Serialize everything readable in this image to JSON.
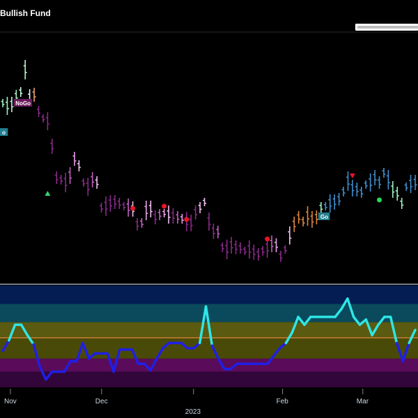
{
  "title": "Bullish Fund",
  "chart_data": {
    "type": "ohlc",
    "price_bars": [
      {
        "v": 148,
        "c": "#9ff0c0"
      },
      {
        "v": 152,
        "c": "#9ff0c0"
      },
      {
        "v": 150,
        "c": "#b8f5d0"
      },
      {
        "v": 138,
        "c": "#9ff0c0"
      },
      {
        "v": 132,
        "c": "#c8f7dc"
      },
      {
        "v": 100,
        "c": "#b8f5d0"
      },
      {
        "v": 140,
        "c": "#e8eefc"
      },
      {
        "v": 136,
        "c": "#f0a070"
      },
      {
        "v": 160,
        "c": "#8a2a8a"
      },
      {
        "v": 170,
        "c": "#8a2a8a"
      },
      {
        "v": 174,
        "c": "#8a2a8a"
      },
      {
        "v": 210,
        "c": "#8a2a8a"
      },
      {
        "v": 255,
        "c": "#8a2a8a"
      },
      {
        "v": 258,
        "c": "#8a2a8a"
      },
      {
        "v": 262,
        "c": "#8a2a8a"
      },
      {
        "v": 252,
        "c": "#c060c0"
      },
      {
        "v": 228,
        "c": "#e8a0e8"
      },
      {
        "v": 238,
        "c": "#f0c0f0"
      },
      {
        "v": 262,
        "c": "#8a2a8a"
      },
      {
        "v": 268,
        "c": "#8a2a8a"
      },
      {
        "v": 258,
        "c": "#c060c0"
      },
      {
        "v": 262,
        "c": "#f0c0f0"
      },
      {
        "v": 298,
        "c": "#8a2a8a"
      },
      {
        "v": 296,
        "c": "#8a2a8a"
      },
      {
        "v": 292,
        "c": "#8a2a8a"
      },
      {
        "v": 290,
        "c": "#8a2a8a"
      },
      {
        "v": 292,
        "c": "#8a2a8a"
      },
      {
        "v": 296,
        "c": "#8a2a8a"
      },
      {
        "v": 298,
        "c": "#c060c0"
      },
      {
        "v": 300,
        "c": "#f0c0f0"
      },
      {
        "v": 322,
        "c": "#8a2a8a"
      },
      {
        "v": 320,
        "c": "#c060c0"
      },
      {
        "v": 302,
        "c": "#e8a0e8"
      },
      {
        "v": 300,
        "c": "#f0c0f0"
      },
      {
        "v": 312,
        "c": "#8a2a8a"
      },
      {
        "v": 308,
        "c": "#c060c0"
      },
      {
        "v": 306,
        "c": "#e8a0e8"
      },
      {
        "v": 308,
        "c": "#f0c0f0"
      },
      {
        "v": 310,
        "c": "#8a2a8a"
      },
      {
        "v": 312,
        "c": "#c060c0"
      },
      {
        "v": 314,
        "c": "#e8a0e8"
      },
      {
        "v": 318,
        "c": "#8a2a8a"
      },
      {
        "v": 320,
        "c": "#8a2a8a"
      },
      {
        "v": 305,
        "c": "#8a2a8a"
      },
      {
        "v": 298,
        "c": "#f0c0f0"
      },
      {
        "v": 290,
        "c": "#f0c0f0"
      },
      {
        "v": 318,
        "c": "#8a2a8a"
      },
      {
        "v": 332,
        "c": "#8a2a8a"
      },
      {
        "v": 333,
        "c": "#c060c0"
      },
      {
        "v": 355,
        "c": "#8a2a8a"
      },
      {
        "v": 358,
        "c": "#8a2a8a"
      },
      {
        "v": 352,
        "c": "#8a2a8a"
      },
      {
        "v": 355,
        "c": "#8a2a8a"
      },
      {
        "v": 356,
        "c": "#8a2a8a"
      },
      {
        "v": 360,
        "c": "#8a2a8a"
      },
      {
        "v": 358,
        "c": "#8a2a8a"
      },
      {
        "v": 362,
        "c": "#8a2a8a"
      },
      {
        "v": 365,
        "c": "#8a2a8a"
      },
      {
        "v": 360,
        "c": "#8a2a8a"
      },
      {
        "v": 356,
        "c": "#8a2a8a"
      },
      {
        "v": 350,
        "c": "#c060c0"
      },
      {
        "v": 352,
        "c": "#e8a0e8"
      },
      {
        "v": 368,
        "c": "#8a2a8a"
      },
      {
        "v": 358,
        "c": "#8a2a8a"
      },
      {
        "v": 338,
        "c": "#f0c0f0"
      },
      {
        "v": 322,
        "c": "#e0863a"
      },
      {
        "v": 312,
        "c": "#e0863a"
      },
      {
        "v": 318,
        "c": "#e0863a"
      },
      {
        "v": 310,
        "c": "#e0863a"
      },
      {
        "v": 315,
        "c": "#e0863a"
      },
      {
        "v": 312,
        "c": "#e0863a"
      },
      {
        "v": 298,
        "c": "#9ff0c0"
      },
      {
        "v": 296,
        "c": "#3f8fd0"
      },
      {
        "v": 292,
        "c": "#3f8fd0"
      },
      {
        "v": 290,
        "c": "#3f8fd0"
      },
      {
        "v": 286,
        "c": "#3f8fd0"
      },
      {
        "v": 275,
        "c": "#3f8fd0"
      },
      {
        "v": 260,
        "c": "#3f8fd0"
      },
      {
        "v": 270,
        "c": "#3f8fd0"
      },
      {
        "v": 272,
        "c": "#3f8fd0"
      },
      {
        "v": 276,
        "c": "#3f8fd0"
      },
      {
        "v": 265,
        "c": "#3f8fd0"
      },
      {
        "v": 262,
        "c": "#3f8fd0"
      },
      {
        "v": 255,
        "c": "#3f8fd0"
      },
      {
        "v": 262,
        "c": "#3f8fd0"
      },
      {
        "v": 248,
        "c": "#3f8fd0"
      },
      {
        "v": 258,
        "c": "#3f8fd0"
      },
      {
        "v": 272,
        "c": "#9ff0c0"
      },
      {
        "v": 278,
        "c": "#9ff0c0"
      },
      {
        "v": 292,
        "c": "#9ff0c0"
      },
      {
        "v": 268,
        "c": "#3f8fd0"
      },
      {
        "v": 264,
        "c": "#3f8fd0"
      },
      {
        "v": 262,
        "c": "#3f8fd0"
      }
    ],
    "markers": [
      {
        "type": "triangle-up",
        "color": "#3ad36e",
        "bar": 10,
        "y": 278
      },
      {
        "type": "dot",
        "color": "#e8152a",
        "bar": 29,
        "y": 299
      },
      {
        "type": "dot",
        "color": "#e8152a",
        "bar": 36,
        "y": 296
      },
      {
        "type": "dot",
        "color": "#e8152a",
        "bar": 41,
        "y": 315
      },
      {
        "type": "dot",
        "color": "#e8152a",
        "bar": 59,
        "y": 343
      },
      {
        "type": "triangle-down",
        "color": "#e8152a",
        "bar": 78,
        "y": 252
      },
      {
        "type": "dot",
        "color": "#28d85a",
        "bar": 84,
        "y": 287
      }
    ],
    "tags": [
      {
        "label": "NoGo",
        "bg": "#6a1a5a",
        "bar": 3,
        "y": 148
      },
      {
        "label": "o",
        "bg": "#237f8f",
        "bar": 0,
        "y": 190
      },
      {
        "label": "Go",
        "bg": "#237f8f",
        "bar": 71,
        "y": 311
      }
    ],
    "oscillator": {
      "series": [
        {
          "x": 0,
          "v": 0.0
        },
        {
          "x": 1,
          "v": 0.8
        },
        {
          "x": 2,
          "v": 2.0
        },
        {
          "x": 3,
          "v": 2.0
        },
        {
          "x": 4,
          "v": 1.2
        },
        {
          "x": 5,
          "v": 0.5
        },
        {
          "x": 6,
          "v": -1.2
        },
        {
          "x": 7,
          "v": -2.2
        },
        {
          "x": 8,
          "v": -1.6
        },
        {
          "x": 9,
          "v": -1.6
        },
        {
          "x": 10,
          "v": -1.6
        },
        {
          "x": 11,
          "v": -0.8
        },
        {
          "x": 12,
          "v": -0.8
        },
        {
          "x": 13,
          "v": 0.6
        },
        {
          "x": 14,
          "v": -0.6
        },
        {
          "x": 15,
          "v": -0.2
        },
        {
          "x": 16,
          "v": -0.2
        },
        {
          "x": 17,
          "v": -0.2
        },
        {
          "x": 18,
          "v": -1.6
        },
        {
          "x": 19,
          "v": 0.1
        },
        {
          "x": 20,
          "v": 0.1
        },
        {
          "x": 21,
          "v": 0.1
        },
        {
          "x": 22,
          "v": -1.0
        },
        {
          "x": 23,
          "v": -1.0
        },
        {
          "x": 24,
          "v": -1.5
        },
        {
          "x": 25,
          "v": -0.6
        },
        {
          "x": 26,
          "v": 0.2
        },
        {
          "x": 27,
          "v": 0.6
        },
        {
          "x": 28,
          "v": 0.6
        },
        {
          "x": 29,
          "v": 0.6
        },
        {
          "x": 30,
          "v": 0.2
        },
        {
          "x": 31,
          "v": 0.2
        },
        {
          "x": 32,
          "v": 0.6
        },
        {
          "x": 33,
          "v": 3.4
        },
        {
          "x": 34,
          "v": 0.4
        },
        {
          "x": 35,
          "v": -0.6
        },
        {
          "x": 36,
          "v": -1.4
        },
        {
          "x": 37,
          "v": -1.4
        },
        {
          "x": 38,
          "v": -1.0
        },
        {
          "x": 39,
          "v": -1.0
        },
        {
          "x": 40,
          "v": -1.0
        },
        {
          "x": 41,
          "v": -1.0
        },
        {
          "x": 42,
          "v": -1.0
        },
        {
          "x": 43,
          "v": -1.0
        },
        {
          "x": 44,
          "v": -0.4
        },
        {
          "x": 45,
          "v": 0.2
        },
        {
          "x": 46,
          "v": 0.6
        },
        {
          "x": 47,
          "v": 1.4
        },
        {
          "x": 48,
          "v": 2.6
        },
        {
          "x": 49,
          "v": 2.0
        },
        {
          "x": 50,
          "v": 2.6
        },
        {
          "x": 51,
          "v": 2.6
        },
        {
          "x": 52,
          "v": 2.6
        },
        {
          "x": 53,
          "v": 2.6
        },
        {
          "x": 54,
          "v": 2.6
        },
        {
          "x": 55,
          "v": 3.2
        },
        {
          "x": 56,
          "v": 4.0
        },
        {
          "x": 57,
          "v": 2.6
        },
        {
          "x": 58,
          "v": 2.0
        },
        {
          "x": 59,
          "v": 2.4
        },
        {
          "x": 60,
          "v": 1.2
        },
        {
          "x": 61,
          "v": 2.0
        },
        {
          "x": 62,
          "v": 2.6
        },
        {
          "x": 63,
          "v": 2.6
        },
        {
          "x": 64,
          "v": 0.6
        },
        {
          "x": 65,
          "v": -0.8
        },
        {
          "x": 66,
          "v": 0.6
        },
        {
          "x": 67,
          "v": 1.6
        }
      ],
      "bands": [
        {
          "color": "#041e54",
          "from": 3.6,
          "to": 5.0
        },
        {
          "color": "#0a4a5c",
          "from": 2.2,
          "to": 3.6
        },
        {
          "color": "#5a5a10",
          "from": 1.0,
          "to": 2.2
        },
        {
          "color": "#4a4a08",
          "from": -0.6,
          "to": 1.0
        },
        {
          "color": "#5a0b5a",
          "from": -1.6,
          "to": -0.6
        },
        {
          "color": "#32063a",
          "from": -2.8,
          "to": -1.6
        }
      ],
      "zero_line": 1.0,
      "ylim": [
        -2.8,
        5.0
      ]
    },
    "x_tick_labels": [
      {
        "label": "Nov",
        "pos": 0.025
      },
      {
        "label": "Dec",
        "pos": 0.243
      },
      {
        "label": "2023",
        "pos": 0.463,
        "row": 2
      },
      {
        "label": "Feb",
        "pos": 0.676
      },
      {
        "label": "Mar",
        "pos": 0.868
      }
    ]
  }
}
